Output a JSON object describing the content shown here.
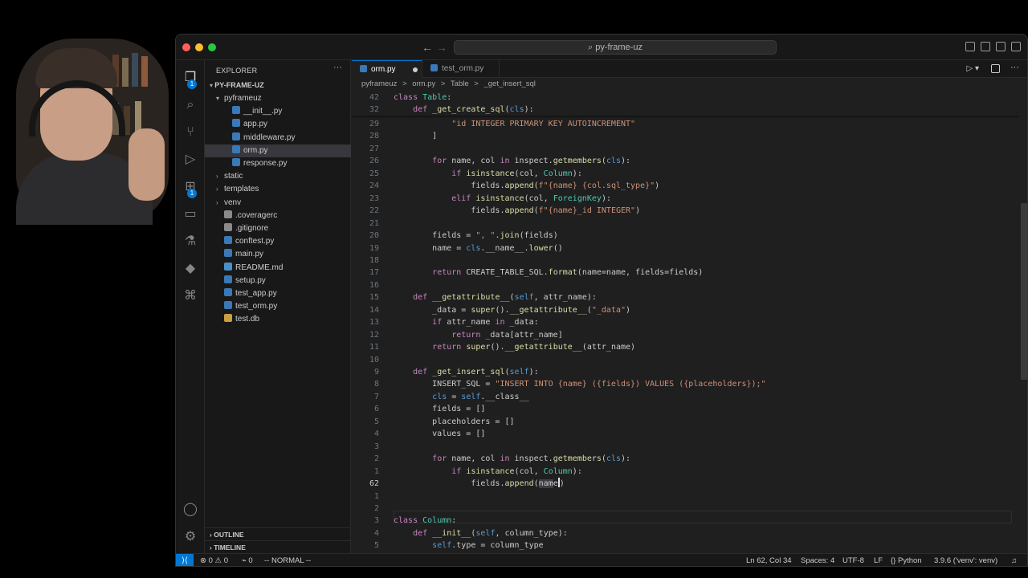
{
  "window": {
    "search": "py-frame-uz"
  },
  "sidebar": {
    "title": "EXPLORER",
    "root": "PY-FRAME-UZ",
    "tree": [
      {
        "label": "pyframeuz",
        "type": "folder-open",
        "depth": 1
      },
      {
        "label": "__init__.py",
        "type": "py",
        "depth": 2
      },
      {
        "label": "app.py",
        "type": "py",
        "depth": 2
      },
      {
        "label": "middleware.py",
        "type": "py",
        "depth": 2
      },
      {
        "label": "orm.py",
        "type": "py",
        "depth": 2,
        "selected": true
      },
      {
        "label": "response.py",
        "type": "py",
        "depth": 2
      },
      {
        "label": "static",
        "type": "folder",
        "depth": 1
      },
      {
        "label": "templates",
        "type": "folder",
        "depth": 1
      },
      {
        "label": "venv",
        "type": "folder",
        "depth": 1
      },
      {
        "label": ".coveragerc",
        "type": "file",
        "depth": 1
      },
      {
        "label": ".gitignore",
        "type": "file",
        "depth": 1
      },
      {
        "label": "conftest.py",
        "type": "py",
        "depth": 1
      },
      {
        "label": "main.py",
        "type": "py",
        "depth": 1
      },
      {
        "label": "README.md",
        "type": "md",
        "depth": 1
      },
      {
        "label": "setup.py",
        "type": "py",
        "depth": 1
      },
      {
        "label": "test_app.py",
        "type": "py",
        "depth": 1
      },
      {
        "label": "test_orm.py",
        "type": "py",
        "depth": 1
      },
      {
        "label": "test.db",
        "type": "db",
        "depth": 1
      }
    ],
    "outline": "OUTLINE",
    "timeline": "TIMELINE"
  },
  "tabs": [
    {
      "label": "orm.py",
      "active": true,
      "dirty": true
    },
    {
      "label": "test_orm.py",
      "active": false
    }
  ],
  "breadcrumb": [
    "pyframeuz",
    ">",
    "orm.py",
    ">",
    "Table",
    ">",
    "_get_insert_sql"
  ],
  "activity_badges": {
    "explorer": "1",
    "extensions": "1"
  },
  "code_lines": [
    {
      "n": "42",
      "t": "class Table:",
      "sticky": true
    },
    {
      "n": "32",
      "t": "    def _get_create_sql(cls):",
      "sticky": true
    },
    {
      "n": "29",
      "t": "            \"id INTEGER PRIMARY KEY AUTOINCREMENT\""
    },
    {
      "n": "28",
      "t": "        ]"
    },
    {
      "n": "27",
      "t": ""
    },
    {
      "n": "26",
      "t": "        for name, col in inspect.getmembers(cls):"
    },
    {
      "n": "25",
      "t": "            if isinstance(col, Column):"
    },
    {
      "n": "24",
      "t": "                fields.append(f\"{name} {col.sql_type}\")"
    },
    {
      "n": "23",
      "t": "            elif isinstance(col, ForeignKey):"
    },
    {
      "n": "22",
      "t": "                fields.append(f\"{name}_id INTEGER\")"
    },
    {
      "n": "21",
      "t": ""
    },
    {
      "n": "20",
      "t": "        fields = \", \".join(fields)"
    },
    {
      "n": "19",
      "t": "        name = cls.__name__.lower()"
    },
    {
      "n": "18",
      "t": ""
    },
    {
      "n": "17",
      "t": "        return CREATE_TABLE_SQL.format(name=name, fields=fields)"
    },
    {
      "n": "16",
      "t": ""
    },
    {
      "n": "15",
      "t": "    def __getattribute__(self, attr_name):"
    },
    {
      "n": "14",
      "t": "        _data = super().__getattribute__(\"_data\")"
    },
    {
      "n": "13",
      "t": "        if attr_name in _data:"
    },
    {
      "n": "12",
      "t": "            return _data[attr_name]"
    },
    {
      "n": "11",
      "t": "        return super().__getattribute__(attr_name)"
    },
    {
      "n": "10",
      "t": ""
    },
    {
      "n": "9",
      "t": "    def _get_insert_sql(self):"
    },
    {
      "n": "8",
      "t": "        INSERT_SQL = \"INSERT INTO {name} ({fields}) VALUES ({placeholders});\""
    },
    {
      "n": "7",
      "t": "        cls = self.__class__"
    },
    {
      "n": "6",
      "t": "        fields = []"
    },
    {
      "n": "5",
      "t": "        placeholders = []"
    },
    {
      "n": "4",
      "t": "        values = []"
    },
    {
      "n": "3",
      "t": ""
    },
    {
      "n": "2",
      "t": "        for name, col in inspect.getmembers(cls):"
    },
    {
      "n": "1",
      "t": "            if isinstance(col, Column):"
    },
    {
      "n": "62",
      "t": "                fields.append(name)",
      "current": true
    },
    {
      "n": "1",
      "t": ""
    },
    {
      "n": "2",
      "t": ""
    },
    {
      "n": "3",
      "t": "class Column:"
    },
    {
      "n": "4",
      "t": "    def __init__(self, column_type):"
    },
    {
      "n": "5",
      "t": "        self.type = column_type"
    }
  ],
  "status": {
    "errors": "0",
    "warnings": "0",
    "ports": "0",
    "mode": "-- NORMAL --",
    "position": "Ln 62, Col 34",
    "spaces": "Spaces: 4",
    "encoding": "UTF-8",
    "eol": "LF",
    "language": "Python",
    "interpreter": "3.9.6 ('venv': venv)"
  },
  "colors": {
    "accent": "#0078d4",
    "bg": "#1f1f1f",
    "sidebar": "#181818"
  }
}
